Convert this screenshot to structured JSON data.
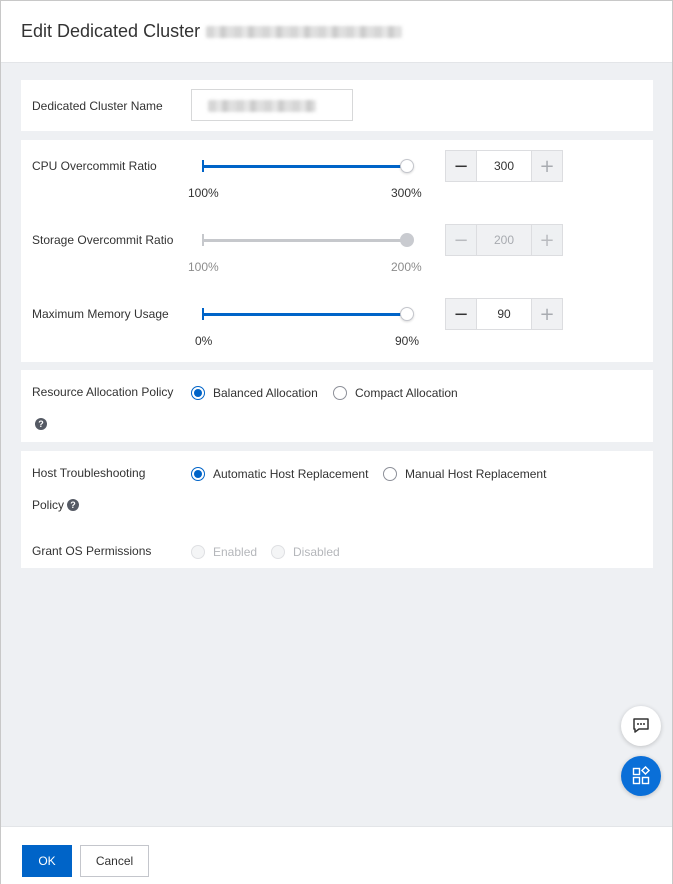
{
  "dialog": {
    "title": "Edit Dedicated Cluster"
  },
  "name_card": {
    "label": "Dedicated Cluster Name"
  },
  "overcommit": {
    "cpu": {
      "label": "CPU Overcommit Ratio",
      "min_label": "100%",
      "max_label": "300%",
      "value": "300",
      "minus": "−",
      "plus": "+",
      "fill": 1.0
    },
    "storage": {
      "label": "Storage Overcommit Ratio",
      "min_label": "100%",
      "max_label": "200%",
      "value": "200",
      "minus": "−",
      "plus": "+",
      "fill": 1.0,
      "disabled": true
    },
    "memory": {
      "label": "Maximum Memory Usage",
      "min_label": "0%",
      "max_label": "90%",
      "value": "90",
      "minus": "−",
      "plus": "+",
      "fill": 1.0
    }
  },
  "allocation": {
    "label": "Resource Allocation Policy",
    "options": [
      "Balanced Allocation",
      "Compact Allocation"
    ],
    "selected": "Balanced Allocation"
  },
  "troubleshooting": {
    "label_line1": "Host Troubleshooting",
    "label_line2": "Policy",
    "options": [
      "Automatic Host Replacement",
      "Manual Host Replacement"
    ],
    "selected": "Automatic Host Replacement"
  },
  "os_permissions": {
    "label": "Grant OS Permissions",
    "options": [
      "Enabled",
      "Disabled"
    ],
    "disabled": true
  },
  "help_glyph": "?",
  "footer": {
    "ok_label": "OK",
    "cancel_label": "Cancel"
  },
  "colors": {
    "primary": "#0064c8",
    "background": "#eef0f3"
  },
  "icons": {
    "chat": "chat-bubble-icon",
    "apps": "apps-grid-icon",
    "help": "question-circle-icon"
  }
}
